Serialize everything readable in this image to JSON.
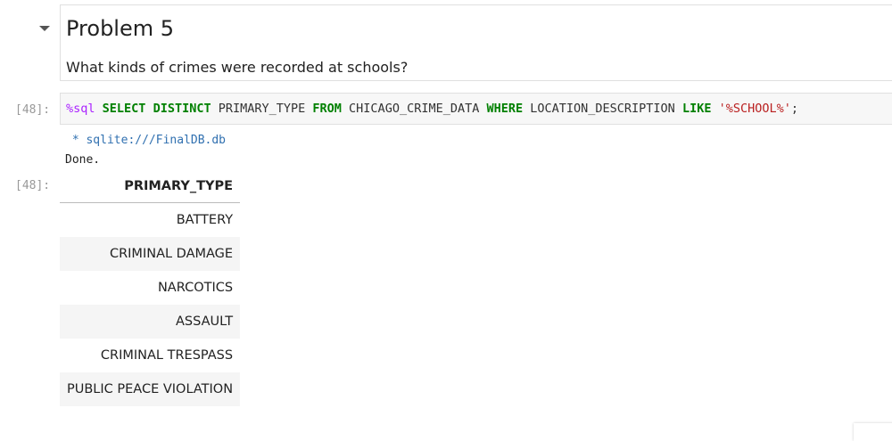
{
  "markdown": {
    "heading": "Problem 5",
    "text": "What kinds of crimes were recorded at schools?"
  },
  "code_cell": {
    "prompt": "[48]:",
    "magic": "%sql",
    "tokens": [
      {
        "t": "SELECT",
        "k": "kw"
      },
      {
        "t": " "
      },
      {
        "t": "DISTINCT",
        "k": "kw"
      },
      {
        "t": " PRIMARY_TYPE "
      },
      {
        "t": "FROM",
        "k": "kw"
      },
      {
        "t": " CHICAGO_CRIME_DATA "
      },
      {
        "t": "WHERE",
        "k": "kw"
      },
      {
        "t": " LOCATION_DESCRIPTION "
      },
      {
        "t": "LIKE",
        "k": "kw"
      },
      {
        "t": " "
      },
      {
        "t": "'%SCHOOL%'",
        "k": "st"
      },
      {
        "t": ";"
      }
    ]
  },
  "output": {
    "connection": " * sqlite:///FinalDB.db",
    "status": "Done.",
    "prompt": "[48]:",
    "table": {
      "header": "PRIMARY_TYPE",
      "rows": [
        "BATTERY",
        "CRIMINAL DAMAGE",
        "NARCOTICS",
        "ASSAULT",
        "CRIMINAL TRESPASS",
        "PUBLIC PEACE VIOLATION"
      ]
    }
  },
  "colors": {
    "keyword": "#008000",
    "magic": "#aa22ff",
    "string": "#ba2121",
    "link": "#3070b0"
  }
}
